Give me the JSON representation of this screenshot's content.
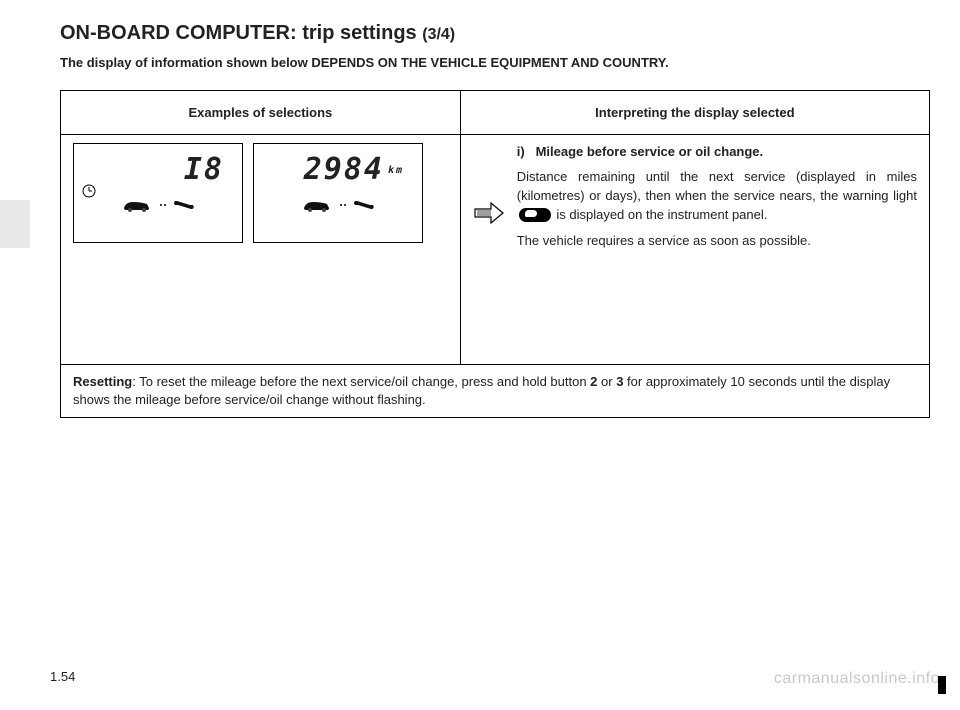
{
  "title": {
    "main": "ON-BOARD COMPUTER: trip settings",
    "pager": "(3/4)"
  },
  "subtitle": "The display of information shown below DEPENDS ON THE VEHICLE EQUIPMENT AND COUNTRY.",
  "table": {
    "header_examples": "Examples of selections",
    "header_interpret": "Interpreting the display selected"
  },
  "displays": {
    "left_value": "I8",
    "right_value": "2984",
    "right_units": "km"
  },
  "interpret": {
    "label": "i)",
    "title": "Mileage before service or oil change.",
    "para1_a": "Distance remaining until the next service (displayed in miles (kilometres) or days), then when the service nears, the warning light ",
    "para1_b": " is displayed on the instrument panel.",
    "para2": "The vehicle requires a service as soon as possible."
  },
  "reset": {
    "label": "Resetting",
    "text_a": ": To reset the mileage before the next service/oil change, press and hold button ",
    "btn_a": "2",
    "text_b": " or ",
    "btn_b": "3",
    "text_c": "  for approximately 10 seconds until the display shows the mileage before service/oil change without flashing."
  },
  "page_number": "1.54",
  "watermark": "carmanualsonline.info"
}
